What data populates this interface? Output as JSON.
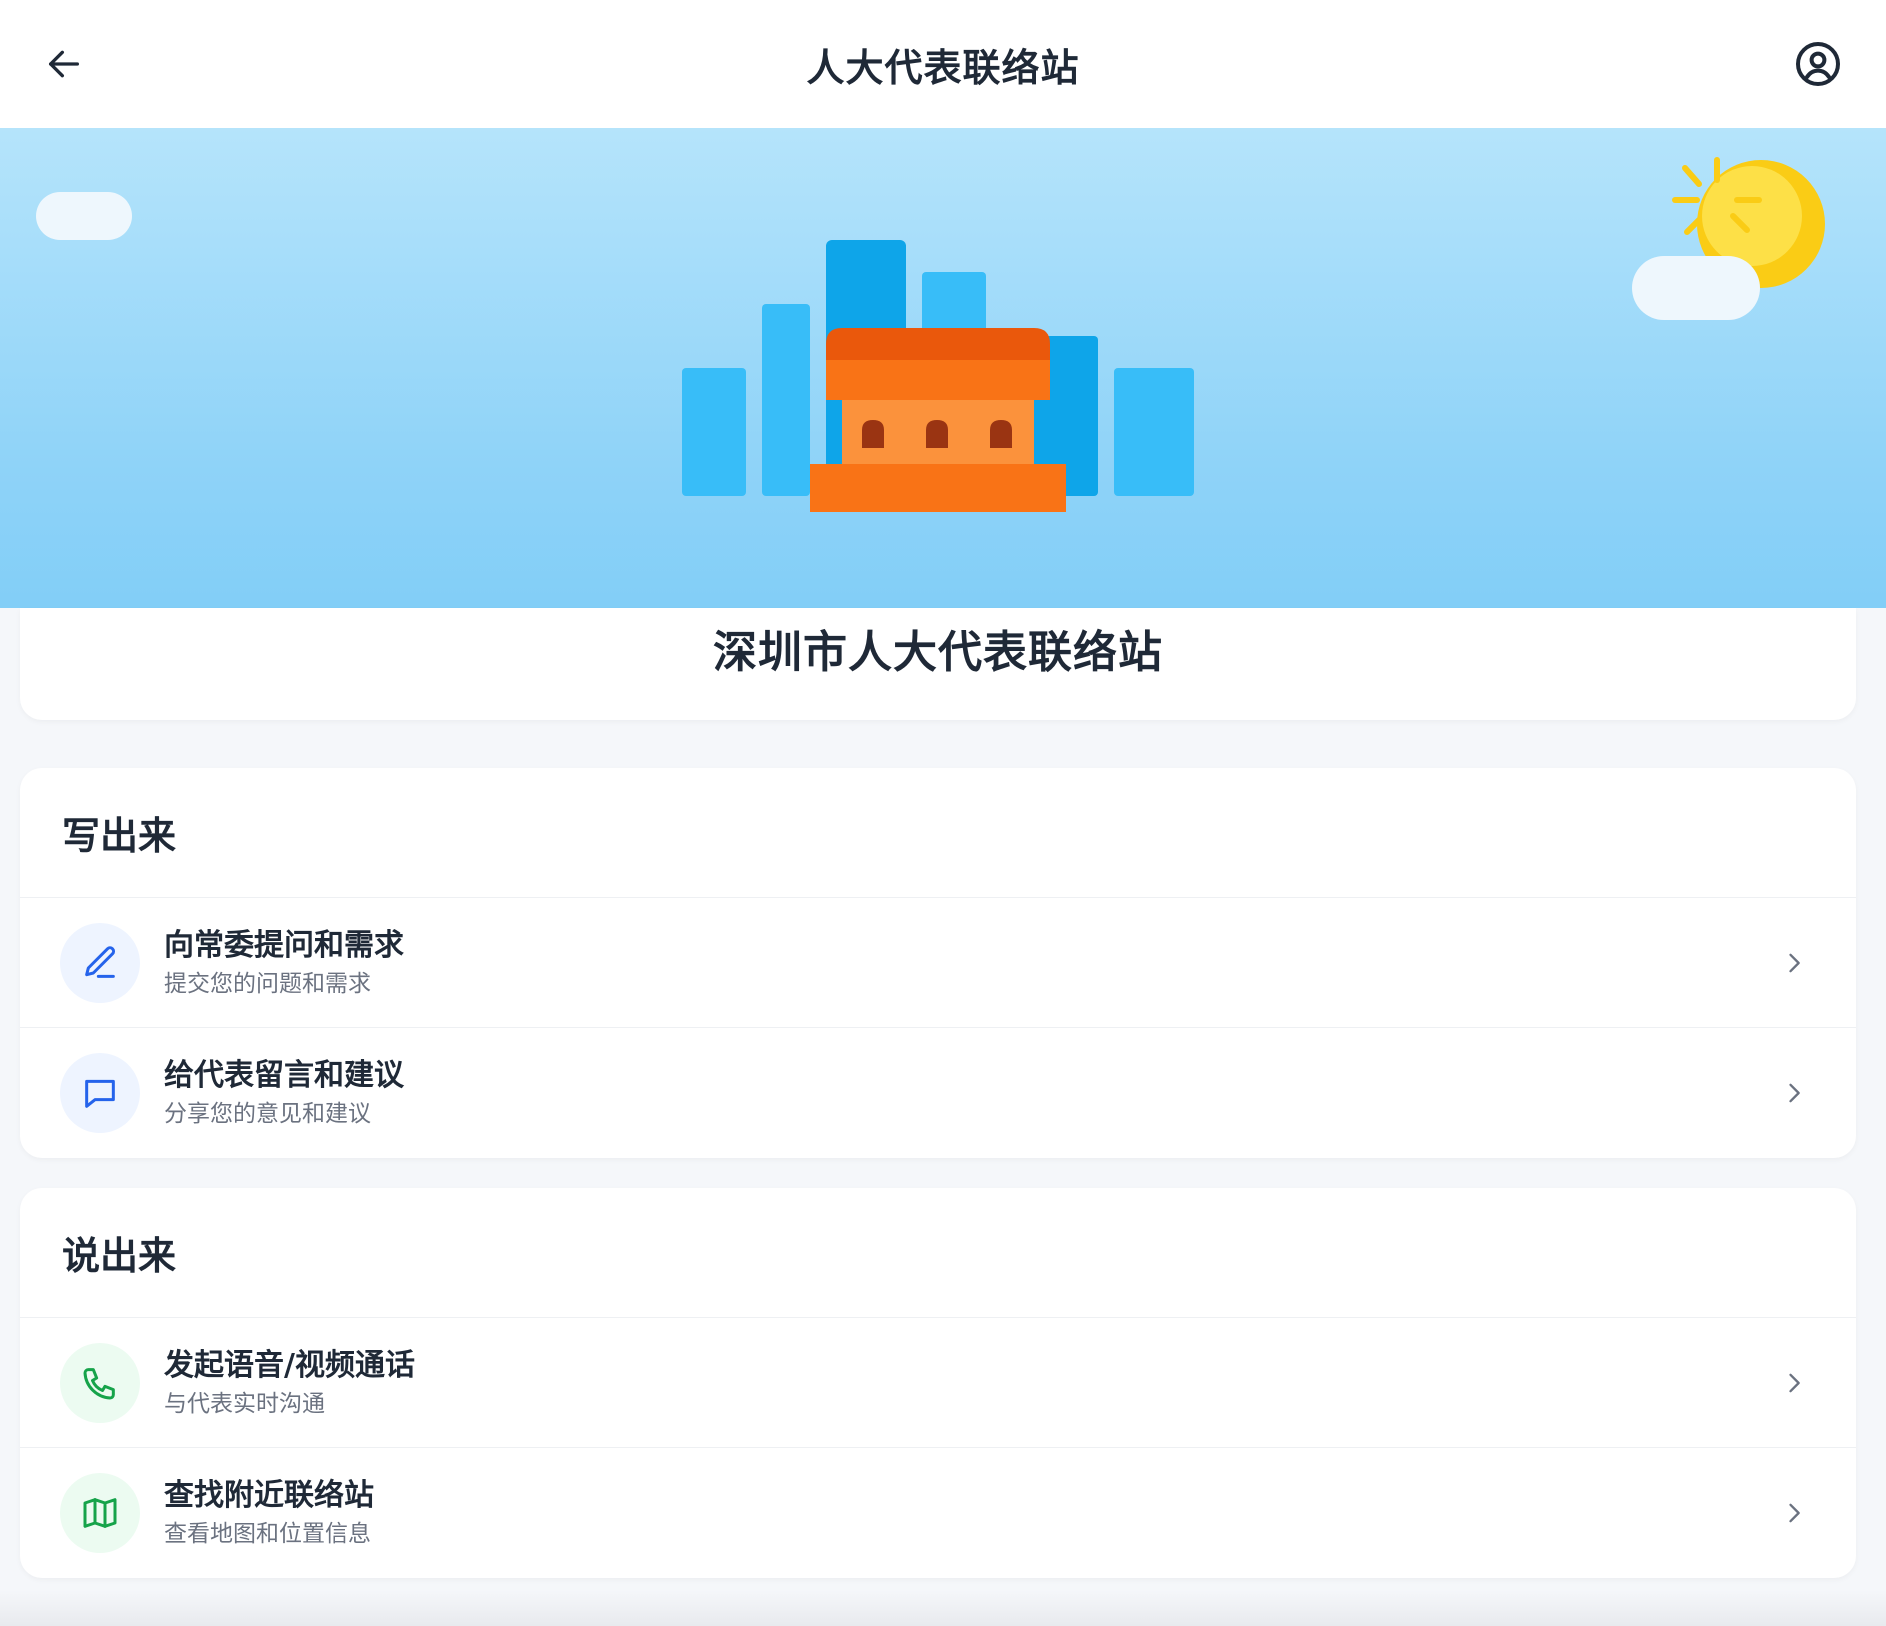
{
  "header": {
    "title": "人大代表联络站",
    "back_icon": "arrow-left-icon",
    "profile_icon": "user-circle-icon"
  },
  "station": {
    "name": "深圳市人大代表联络站"
  },
  "colors": {
    "accent_blue": "#2563eb",
    "accent_green": "#16a34a",
    "banner_top": "#b5e4fb",
    "banner_bottom": "#82cef7",
    "building_orange": "#f97316",
    "sun_yellow": "#facc15"
  },
  "sections": [
    {
      "title": "写出来",
      "items": [
        {
          "title": "向常委提问和需求",
          "subtitle": "提交您的问题和需求",
          "icon": "pencil-icon"
        },
        {
          "title": "给代表留言和建议",
          "subtitle": "分享您的意见和建议",
          "icon": "chat-bubble-icon"
        }
      ]
    },
    {
      "title": "说出来",
      "items": [
        {
          "title": "发起语音/视频通话",
          "subtitle": "与代表实时沟通",
          "icon": "phone-icon"
        },
        {
          "title": "查找附近联络站",
          "subtitle": "查看地图和位置信息",
          "icon": "map-icon"
        }
      ]
    }
  ]
}
